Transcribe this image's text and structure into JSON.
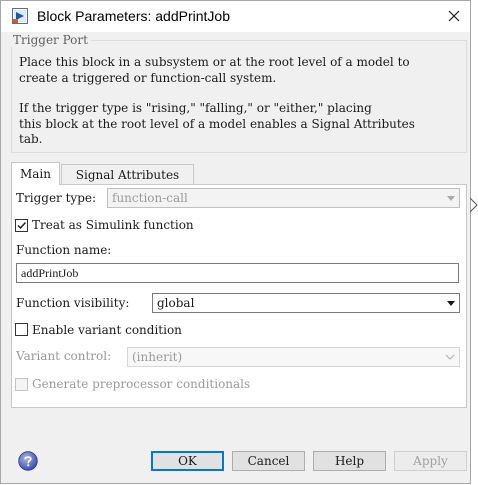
{
  "window": {
    "title": "Block Parameters: addPrintJob",
    "app_icon": "simulink-block-icon",
    "close_icon": "close-icon"
  },
  "description": {
    "group_title": "Trigger Port",
    "line1": "Place this block in a subsystem or at the root level of a model to",
    "line2": "create a triggered or function-call system.",
    "line3": "If the trigger type is \"rising,\" \"falling,\" or \"either,\" placing",
    "line4": "this block at the root level of a model enables a Signal Attributes",
    "line5": "tab."
  },
  "tabs": [
    {
      "label": "Main",
      "selected": true
    },
    {
      "label": "Signal Attributes",
      "selected": false
    }
  ],
  "params": {
    "trigger_type_label": "Trigger type:",
    "trigger_type_value": "function-call",
    "treat_as_simulink_label": "Treat as Simulink function",
    "treat_as_simulink_checked": true,
    "function_name_label": "Function name:",
    "function_name_value": "addPrintJob",
    "function_visibility_label": "Function visibility:",
    "function_visibility_value": "global",
    "enable_variant_label": "Enable variant condition",
    "enable_variant_checked": false,
    "variant_control_label": "Variant control:",
    "variant_control_value": "(inherit)",
    "generate_preprocessor_label": "Generate preprocessor conditionals",
    "generate_preprocessor_checked": false
  },
  "buttons": {
    "ok": "OK",
    "cancel": "Cancel",
    "help": "Help",
    "apply": "Apply"
  },
  "colors": {
    "accent": "#0078d7",
    "window_bg": "#f0f0f0",
    "disabled_text": "#9a9a9a"
  }
}
